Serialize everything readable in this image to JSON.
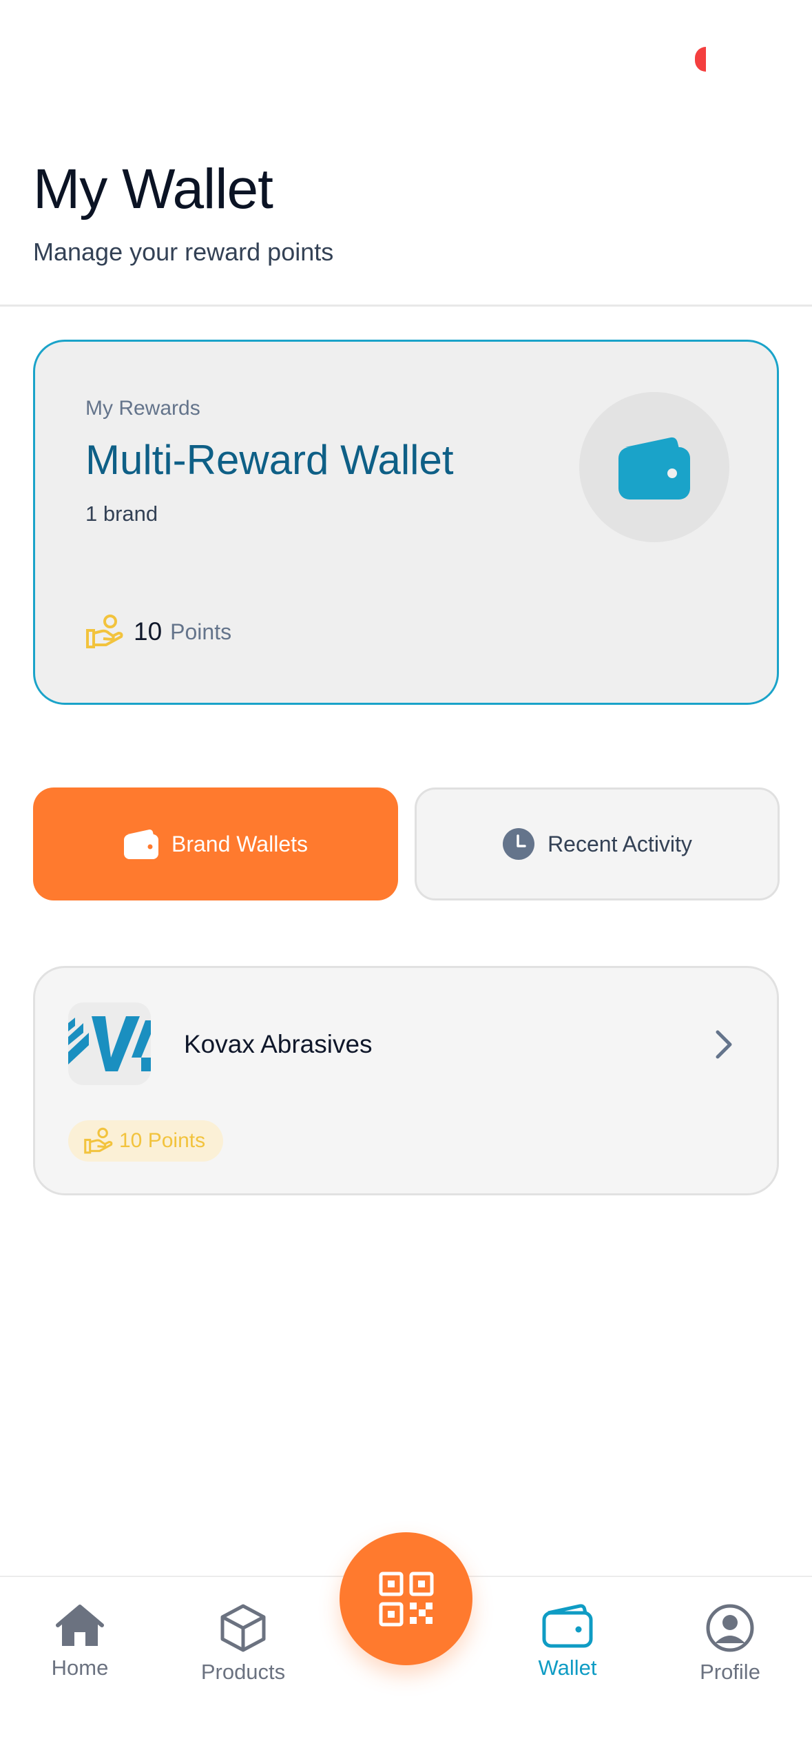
{
  "header": {
    "title": "My Wallet",
    "subtitle": "Manage your reward points"
  },
  "rewards_card": {
    "label": "My Rewards",
    "title": "Multi-Reward Wallet",
    "brand_count": "1 brand",
    "points_value": "10",
    "points_unit": "Points",
    "icon": "wallet-icon"
  },
  "tabs": {
    "brand_wallets": "Brand Wallets",
    "recent_activity": "Recent Activity"
  },
  "brand_list": [
    {
      "name": "Kovax Abrasives",
      "points": "10 Points"
    }
  ],
  "bottom_nav": {
    "home": "Home",
    "products": "Products",
    "wallet": "Wallet",
    "profile": "Profile",
    "active": "wallet"
  },
  "colors": {
    "accent_orange": "#ff7a2e",
    "accent_teal": "#1aa3c9",
    "points_gold": "#f2c33d"
  }
}
